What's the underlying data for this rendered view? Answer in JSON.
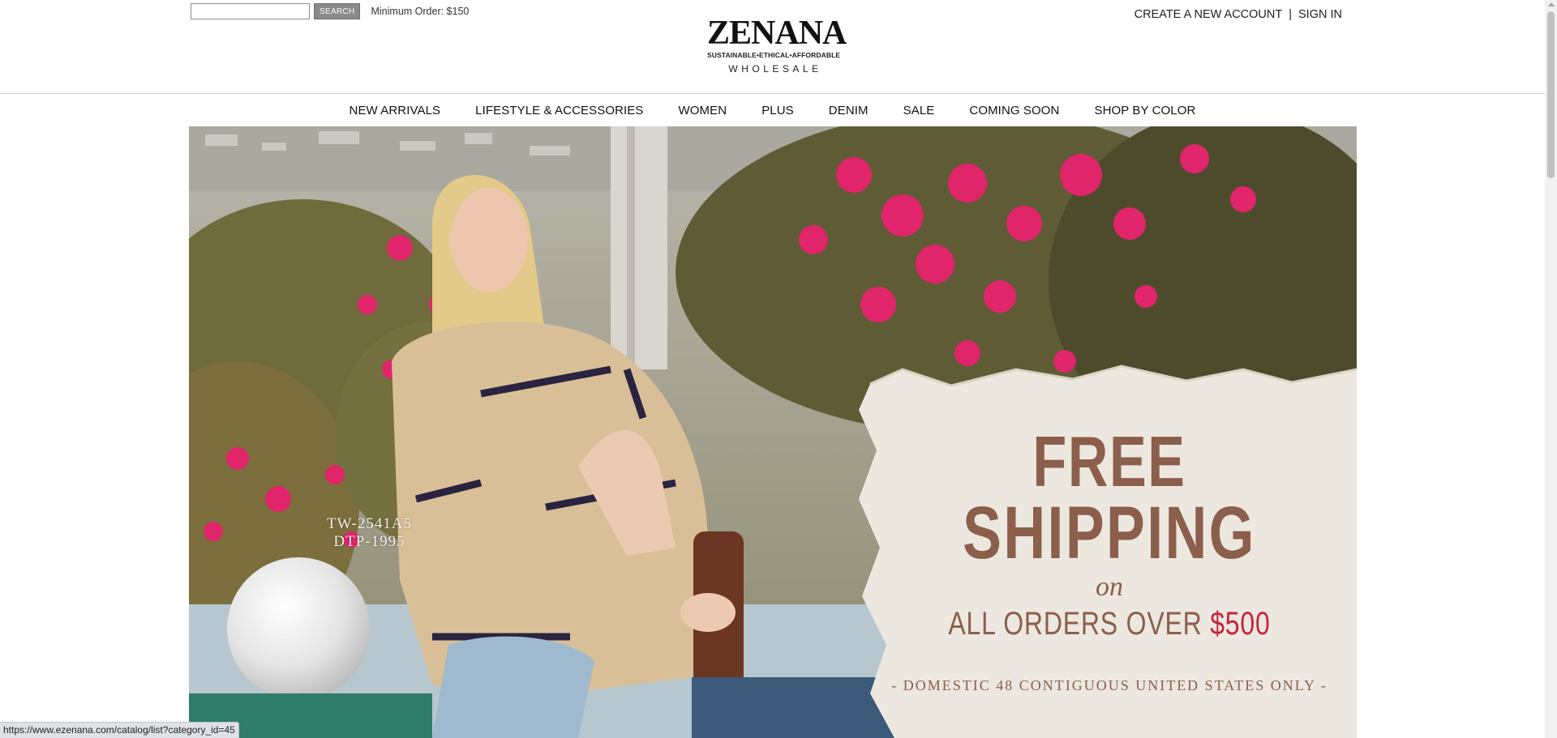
{
  "header": {
    "search_placeholder": "",
    "search_button": "SEARCH",
    "min_order": "Minimum Order: $150",
    "logo": {
      "name": "ZENANA",
      "tagline": "SUSTAINABLE•ETHICAL•AFFORDABLE",
      "sub": "WHOLESALE"
    },
    "create_account": "CREATE A NEW ACCOUNT",
    "separator": "|",
    "sign_in": "SIGN IN"
  },
  "nav": {
    "items": [
      {
        "label": "NEW ARRIVALS"
      },
      {
        "label": "LIFESTYLE & ACCESSORIES"
      },
      {
        "label": "WOMEN"
      },
      {
        "label": "PLUS"
      },
      {
        "label": "DENIM"
      },
      {
        "label": "SALE"
      },
      {
        "label": "COMING SOON"
      },
      {
        "label": "SHOP BY COLOR"
      }
    ]
  },
  "hero": {
    "sku_line1": "TW-2541A5",
    "sku_line2": "DTP-1995",
    "promo_free": "FREE",
    "promo_shipping": "SHIPPING",
    "promo_on": "on",
    "promo_orders_prefix": "ALL ORDERS OVER ",
    "promo_orders_amount": "$500",
    "promo_domestic": "- DOMESTIC 48 CONTIGUOUS UNITED STATES ONLY -"
  },
  "status_bar": {
    "url": "https://www.ezenana.com/catalog/list?category_id=45"
  },
  "colors": {
    "promo_text": "#8c5e4c",
    "promo_accent": "#c4253c",
    "paper": "#ece8df"
  }
}
